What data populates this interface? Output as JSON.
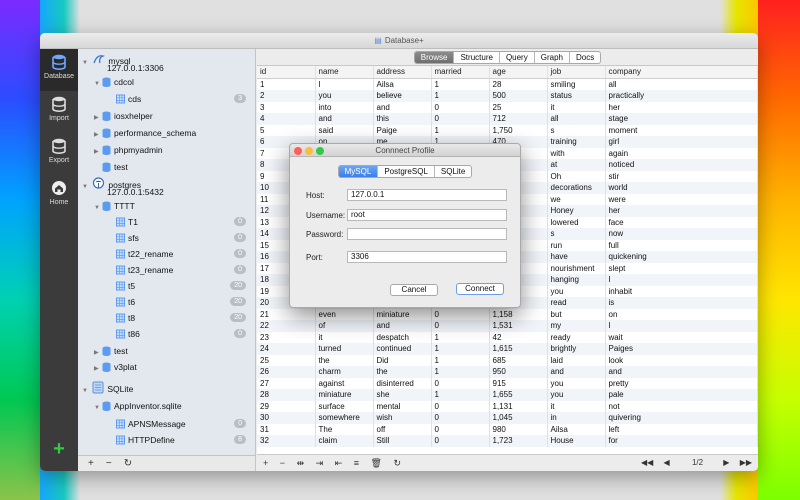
{
  "window": {
    "title": "Database+"
  },
  "leftbar": {
    "items": [
      {
        "label": "Database",
        "icon": "database-icon"
      },
      {
        "label": "Import",
        "icon": "import-icon"
      },
      {
        "label": "Export",
        "icon": "export-icon"
      },
      {
        "label": "Home",
        "icon": "home-icon"
      }
    ],
    "add": "+"
  },
  "tree": {
    "mysql": {
      "name": "mysql",
      "host": "127.0.0.1:3306"
    },
    "cdcol": "cdcol",
    "cds": {
      "name": "cds",
      "count": "3"
    },
    "iosxhelper": "iosxhelper",
    "performance_schema": "performance_schema",
    "phpmyadmin": "phpmyadmin",
    "test1": "test",
    "postgres": {
      "name": "postgres",
      "host": "127.0.0.1:5432"
    },
    "TTTT": "TTTT",
    "pg_tables": [
      {
        "name": "T1",
        "count": "0"
      },
      {
        "name": "sfs",
        "count": "0"
      },
      {
        "name": "t22_rename",
        "count": "0"
      },
      {
        "name": "t23_rename",
        "count": "0"
      },
      {
        "name": "t5",
        "count": "20"
      },
      {
        "name": "t6",
        "count": "20"
      },
      {
        "name": "t8",
        "count": "20"
      },
      {
        "name": "t86",
        "count": "0"
      }
    ],
    "test2": "test",
    "v3plat": "v3plat",
    "sqlite": "SQLite",
    "appinventor": "AppInventor.sqlite",
    "sqlite_tables": [
      {
        "name": "APNSMessage",
        "count": "0"
      },
      {
        "name": "HTTPDefine",
        "count": "8"
      }
    ],
    "footer": [
      "+",
      "−",
      "↻"
    ]
  },
  "tabs": [
    "Browse",
    "Structure",
    "Query",
    "Graph",
    "Docs"
  ],
  "table": {
    "columns": [
      "id",
      "name",
      "address",
      "married",
      "age",
      "job",
      "company"
    ],
    "rows": [
      [
        "1",
        "I",
        "Ailsa",
        "1",
        "28",
        "smiling",
        "all"
      ],
      [
        "2",
        "you",
        "believe",
        "1",
        "500",
        "status",
        "practically"
      ],
      [
        "3",
        "into",
        "and",
        "0",
        "25",
        "it",
        "her"
      ],
      [
        "4",
        "and",
        "this",
        "0",
        "712",
        "all",
        "stage"
      ],
      [
        "5",
        "said",
        "Paige",
        "1",
        "1,750",
        "s",
        "moment"
      ],
      [
        "6",
        "on",
        "me",
        "1",
        "470",
        "training",
        "girl"
      ],
      [
        "7",
        "",
        "",
        "",
        "",
        "with",
        "again"
      ],
      [
        "8",
        "",
        "",
        "",
        "",
        "at",
        "noticed"
      ],
      [
        "9",
        "",
        "",
        "",
        "",
        "Oh",
        "stir"
      ],
      [
        "10",
        "",
        "",
        "",
        "",
        "decorations",
        "world"
      ],
      [
        "11",
        "",
        "",
        "",
        "",
        "we",
        "were"
      ],
      [
        "12",
        "",
        "",
        "",
        "",
        "Honey",
        "her"
      ],
      [
        "13",
        "",
        "",
        "",
        "",
        "lowered",
        "face"
      ],
      [
        "14",
        "",
        "",
        "",
        "",
        "s",
        "now"
      ],
      [
        "15",
        "",
        "",
        "",
        "",
        "run",
        "full"
      ],
      [
        "16",
        "",
        "",
        "",
        "",
        "have",
        "quickening"
      ],
      [
        "17",
        "",
        "",
        "",
        "",
        "nourishment",
        "slept"
      ],
      [
        "18",
        "",
        "",
        "",
        "",
        "hanging",
        "I"
      ],
      [
        "19",
        "",
        "",
        "",
        "",
        "you",
        "inhabit"
      ],
      [
        "20",
        "",
        "",
        "",
        "",
        "read",
        "is"
      ],
      [
        "21",
        "even",
        "miniature",
        "0",
        "1,158",
        "but",
        "on"
      ],
      [
        "22",
        "of",
        "and",
        "0",
        "1,531",
        "my",
        "I"
      ],
      [
        "23",
        "it",
        "despatch",
        "1",
        "42",
        "ready",
        "wait"
      ],
      [
        "24",
        "turned",
        "continued",
        "1",
        "1,615",
        "brightly",
        "Paiges"
      ],
      [
        "25",
        "the",
        "Did",
        "1",
        "685",
        "laid",
        "look"
      ],
      [
        "26",
        "charm",
        "the",
        "1",
        "950",
        "and",
        "and"
      ],
      [
        "27",
        "against",
        "disinterred",
        "0",
        "915",
        "you",
        "pretty"
      ],
      [
        "28",
        "miniature",
        "she",
        "1",
        "1,655",
        "you",
        "pale"
      ],
      [
        "29",
        "surface",
        "mental",
        "0",
        "1,131",
        "it",
        "not"
      ],
      [
        "30",
        "somewhere",
        "wish",
        "0",
        "1,045",
        "in",
        "quivering"
      ],
      [
        "31",
        "The",
        "off",
        "0",
        "980",
        "Ailsa",
        "left"
      ],
      [
        "32",
        "claim",
        "Still",
        "0",
        "1,723",
        "House",
        "for"
      ]
    ]
  },
  "footer": {
    "tools": [
      "+",
      "−",
      "⇹",
      "⇥",
      "⇤",
      "≡",
      "🗑",
      "↻"
    ],
    "page": "1/2"
  },
  "dialog": {
    "title": "Connnect Profile",
    "tabs": [
      "MySQL",
      "PostgreSQL",
      "SQLite"
    ],
    "host_label": "Host:",
    "host": "127.0.0.1",
    "username_label": "Username:",
    "username": "root",
    "password_label": "Password:",
    "password": "",
    "port_label": "Port:",
    "port": "3306",
    "cancel": "Cancel",
    "connect": "Connect"
  }
}
